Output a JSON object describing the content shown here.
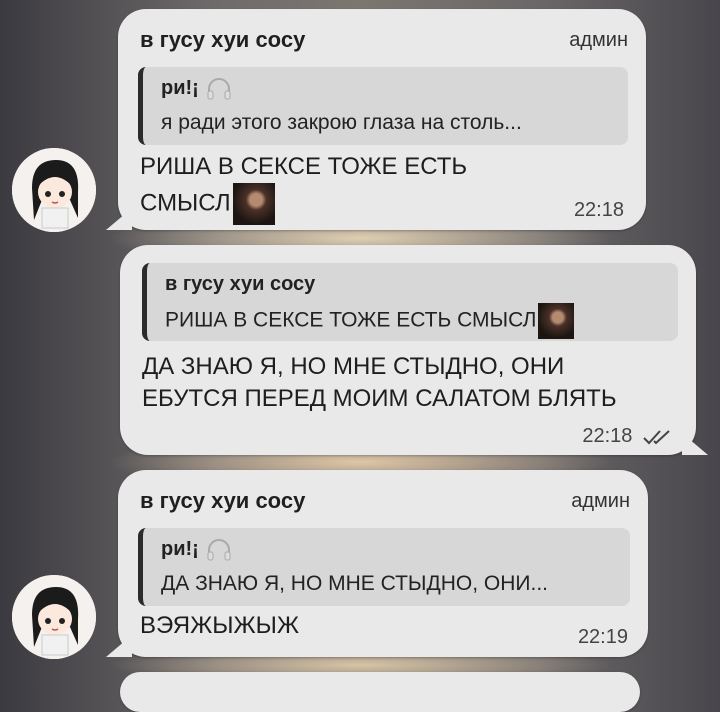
{
  "messages": [
    {
      "sender": "в гусу хуи сосу",
      "role": "админ",
      "quote_name": "ри!¡",
      "quote_text": "я ради этого закрою глаза на столь...",
      "text_line1": "РИША В СЕКСЕ ТОЖЕ ЕСТЬ",
      "text_line2": "СМЫСЛ",
      "time": "22:18"
    },
    {
      "quote_name": "в гусу хуи сосу",
      "quote_text": "РИША В СЕКСЕ ТОЖЕ ЕСТЬ СМЫСЛ",
      "text_line1": "ДА ЗНАЮ Я, НО МНЕ СТЫДНО, ОНИ",
      "text_line2": "ЕБУТСЯ ПЕРЕД МОИМ САЛАТОМ БЛЯТЬ",
      "time": "22:18",
      "read_icon": "double-check-icon"
    },
    {
      "sender": "в гусу хуи сосу",
      "role": "админ",
      "quote_name": "ри!¡",
      "quote_text": "ДА ЗНАЮ Я, НО МНЕ СТЫДНО, ОНИ...",
      "text_line1": "ВЭЯЖЫЖЫЖ",
      "time": "22:19"
    }
  ],
  "icons": {
    "avatar": "anime-character-avatar",
    "headphones": "headphones-icon",
    "sticker": "movie-frame-emoji"
  },
  "colors": {
    "bubble": "#e9e9ea",
    "quote_bg": "#d7d7d8",
    "quote_bar": "#2b2b2b"
  }
}
